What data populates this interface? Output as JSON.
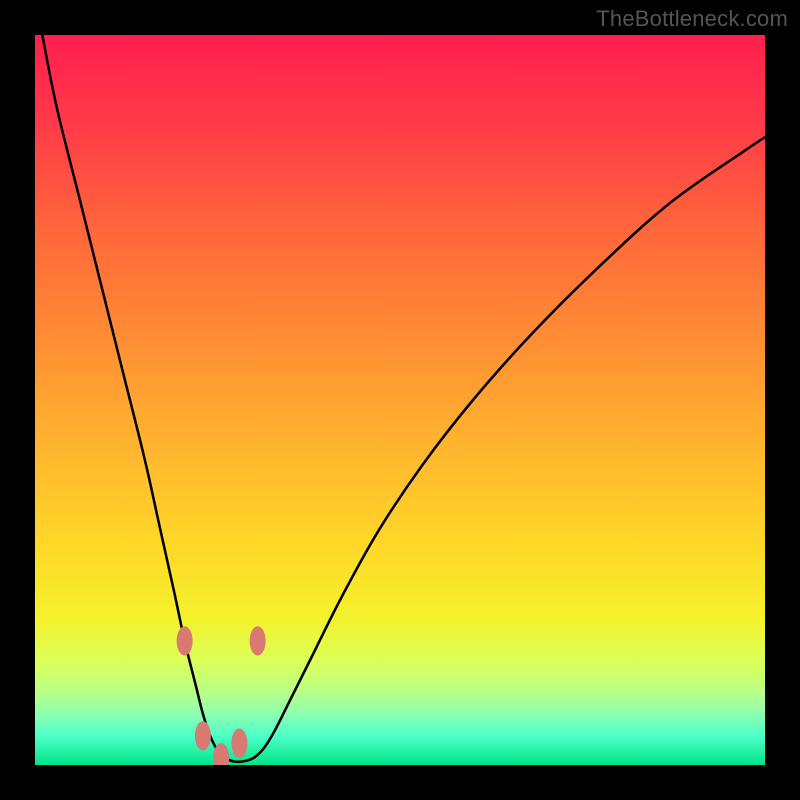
{
  "watermark": "TheBottleneck.com",
  "colors": {
    "frame_border": "#000000",
    "curve": "#000000",
    "bead": "#d87a72",
    "gradient_stops": [
      {
        "offset": 0.0,
        "color": "#ff1f4f"
      },
      {
        "offset": 0.12,
        "color": "#ff3a48"
      },
      {
        "offset": 0.28,
        "color": "#ff6a3a"
      },
      {
        "offset": 0.42,
        "color": "#ff8e34"
      },
      {
        "offset": 0.56,
        "color": "#ffb42e"
      },
      {
        "offset": 0.7,
        "color": "#ffd828"
      },
      {
        "offset": 0.8,
        "color": "#f4f22c"
      },
      {
        "offset": 0.86,
        "color": "#d9ff5a"
      },
      {
        "offset": 0.9,
        "color": "#b8ff88"
      },
      {
        "offset": 0.93,
        "color": "#8cffb0"
      },
      {
        "offset": 0.96,
        "color": "#4effc8"
      },
      {
        "offset": 1.0,
        "color": "#00e58a"
      }
    ]
  },
  "chart_data": {
    "type": "line",
    "title": "",
    "xlabel": "",
    "ylabel": "",
    "xlim": [
      0,
      100
    ],
    "ylim": [
      0,
      100
    ],
    "series": [
      {
        "name": "bottleneck-curve",
        "x": [
          1,
          3,
          6,
          9,
          12,
          15,
          17,
          19,
          20.5,
          22,
          23,
          24,
          25,
          26,
          27.2,
          28.5,
          30,
          31.5,
          33,
          35,
          38,
          42,
          47,
          53,
          60,
          68,
          77,
          87,
          97,
          100
        ],
        "y": [
          100,
          90,
          78,
          66,
          54,
          42,
          33,
          24,
          17,
          11,
          7,
          4,
          2,
          1,
          0.5,
          0.5,
          1,
          2.5,
          5,
          9,
          15,
          23,
          32,
          41,
          50,
          59,
          68,
          77,
          84,
          86
        ]
      }
    ],
    "annotations": {
      "valley_x_range": [
        19,
        30
      ],
      "beads": [
        {
          "x": 20.5,
          "y": 17,
          "rx": 1.1,
          "ry": 2.0
        },
        {
          "x": 23.0,
          "y": 4,
          "rx": 1.1,
          "ry": 2.0
        },
        {
          "x": 25.5,
          "y": 1,
          "rx": 1.1,
          "ry": 2.0
        },
        {
          "x": 28.0,
          "y": 3,
          "rx": 1.1,
          "ry": 2.0
        },
        {
          "x": 30.5,
          "y": 17,
          "rx": 1.1,
          "ry": 2.0
        }
      ]
    }
  }
}
